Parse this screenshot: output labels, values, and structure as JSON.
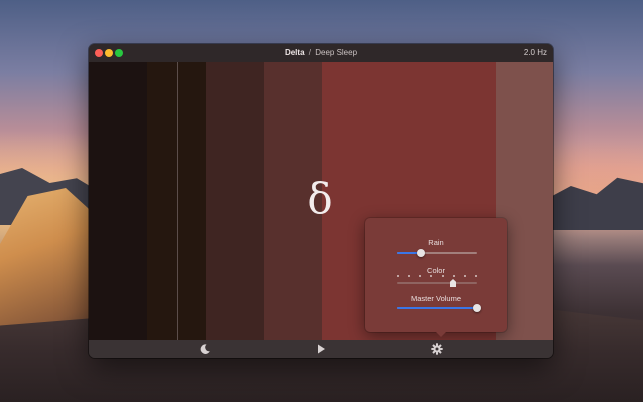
{
  "window": {
    "title_main": "Delta",
    "title_separator": "/",
    "title_sub": "Deep Sleep",
    "frequency": "2.0 Hz"
  },
  "visualizer": {
    "glyph": "δ",
    "band_colors": [
      "#1c1211",
      "#25170f",
      "#3f2522",
      "#58302d",
      "#7c3532",
      "#7e514c"
    ]
  },
  "popover": {
    "rain": {
      "label": "Rain",
      "value_fraction": 0.3
    },
    "color": {
      "label": "Color",
      "value_fraction": 0.7,
      "tick_count": 8
    },
    "master_volume": {
      "label": "Master Volume",
      "value_fraction": 1.0
    }
  },
  "toolbar": {
    "icons": [
      "moon-icon",
      "play-icon",
      "gear-icon"
    ]
  },
  "colors": {
    "accent": "#3b76e6",
    "popover_background": "#7a3b38"
  }
}
